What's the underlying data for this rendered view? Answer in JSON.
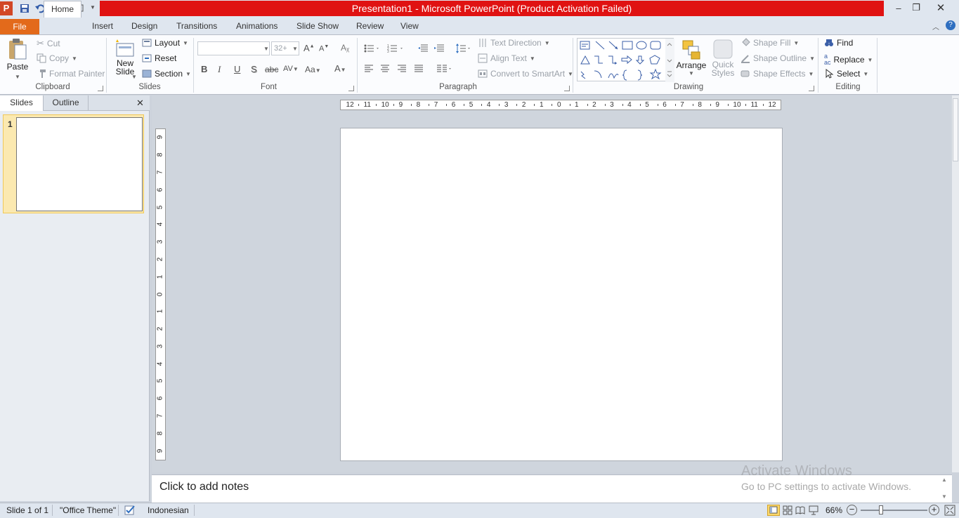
{
  "window": {
    "title": "Presentation1  -  Microsoft PowerPoint (Product Activation Failed)",
    "title_bar_color": "#e01212"
  },
  "tabs": {
    "file": "File",
    "home": "Home",
    "insert": "Insert",
    "design": "Design",
    "transitions": "Transitions",
    "animations": "Animations",
    "slide_show": "Slide Show",
    "review": "Review",
    "view": "View"
  },
  "ribbon": {
    "clipboard": {
      "label": "Clipboard",
      "paste": "Paste",
      "cut": "Cut",
      "copy": "Copy",
      "format_painter": "Format Painter"
    },
    "slides": {
      "label": "Slides",
      "new_slide_1": "New",
      "new_slide_2": "Slide",
      "layout": "Layout",
      "reset": "Reset",
      "section": "Section"
    },
    "font": {
      "label": "Font",
      "font_size": "32+",
      "bold": "B",
      "italic": "I",
      "underline": "U",
      "shadow": "S",
      "strike": "abc",
      "spacing": "AV",
      "case": "Aa",
      "color": "A"
    },
    "paragraph": {
      "label": "Paragraph",
      "text_direction": "Text Direction",
      "align_text": "Align Text",
      "convert_smartart": "Convert to SmartArt"
    },
    "drawing": {
      "label": "Drawing",
      "arrange": "Arrange",
      "quick_styles_1": "Quick",
      "quick_styles_2": "Styles",
      "shape_fill": "Shape Fill",
      "shape_outline": "Shape Outline",
      "shape_effects": "Shape Effects"
    },
    "editing": {
      "label": "Editing",
      "find": "Find",
      "replace": "Replace",
      "select": "Select"
    }
  },
  "left_panel": {
    "tab_slides": "Slides",
    "tab_outline": "Outline",
    "slide_number": "1"
  },
  "rulers": {
    "horizontal": [
      "12",
      "11",
      "10",
      "9",
      "8",
      "7",
      "6",
      "5",
      "4",
      "3",
      "2",
      "1",
      "0",
      "1",
      "2",
      "3",
      "4",
      "5",
      "6",
      "7",
      "8",
      "9",
      "10",
      "11",
      "12"
    ],
    "vertical": [
      "9",
      "8",
      "7",
      "6",
      "5",
      "4",
      "3",
      "2",
      "1",
      "0",
      "1",
      "2",
      "3",
      "4",
      "5",
      "6",
      "7",
      "8",
      "9"
    ]
  },
  "notes": {
    "placeholder": "Click to add notes"
  },
  "watermark": {
    "line1": "Activate Windows",
    "line2": "Go to PC settings to activate Windows."
  },
  "status_bar": {
    "slide_info": "Slide 1 of 1",
    "theme": "\"Office Theme\"",
    "language": "Indonesian",
    "zoom": "66%"
  }
}
